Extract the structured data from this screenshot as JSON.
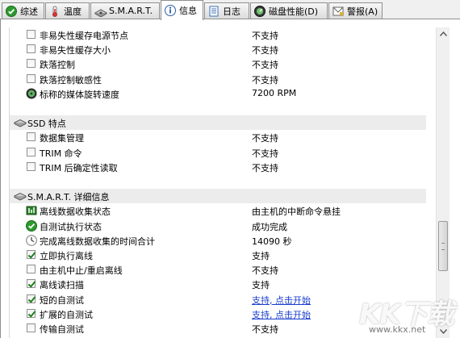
{
  "tabs": [
    {
      "label": "综述",
      "icon": "green-check-icon",
      "active": false
    },
    {
      "label": "温度",
      "icon": "thermometer-icon",
      "active": false
    },
    {
      "label": "S.M.A.R.T.",
      "icon": "hard-drive-icon",
      "active": false
    },
    {
      "label": "信息",
      "icon": "info-icon",
      "active": true
    },
    {
      "label": "日志",
      "icon": "log-document-icon",
      "active": false
    },
    {
      "label": "磁盘性能(D)",
      "icon": "performance-gauge-icon",
      "active": false
    },
    {
      "label": "警报(A)",
      "icon": "alert-envelope-icon",
      "active": false
    }
  ],
  "rows": [
    {
      "type": "row",
      "label": "非易失性缓存电源节点",
      "value": "不支持",
      "icon": "checkbox",
      "checked": false
    },
    {
      "type": "row",
      "label": "非易失性缓存大小",
      "value": "不支持",
      "icon": "checkbox",
      "checked": false
    },
    {
      "type": "row",
      "label": "跌落控制",
      "value": "不支持",
      "icon": "checkbox",
      "checked": false
    },
    {
      "type": "row",
      "label": "跌落控制敏感性",
      "value": "不支持",
      "icon": "checkbox",
      "checked": false
    },
    {
      "type": "row",
      "label": "标称的媒体旋转速度",
      "value": "7200 RPM",
      "icon": "spin-disc-icon"
    },
    {
      "type": "blank"
    },
    {
      "type": "section",
      "label": "SSD 特点"
    },
    {
      "type": "row",
      "label": "数据集管理",
      "value": "不支持",
      "icon": "checkbox",
      "checked": false
    },
    {
      "type": "row",
      "label": "TRIM 命令",
      "value": "不支持",
      "icon": "checkbox",
      "checked": false
    },
    {
      "type": "row",
      "label": "TRIM 后确定性读取",
      "value": "不支持",
      "icon": "checkbox",
      "checked": false
    },
    {
      "type": "blank"
    },
    {
      "type": "section",
      "label": "S.M.A.R.T. 详细信息"
    },
    {
      "type": "row",
      "label": "离线数据收集状态",
      "value": "由主机的中断命令悬挂",
      "icon": "data-collect-icon"
    },
    {
      "type": "row",
      "label": "自测试执行状态",
      "value": "成功完成",
      "icon": "green-check-circle-icon"
    },
    {
      "type": "row",
      "label": "完成离线数据收集的时间合计",
      "value": "14090 秒",
      "icon": "clock-icon"
    },
    {
      "type": "row",
      "label": "立即执行离线",
      "value": "支持",
      "icon": "checkbox",
      "checked": true
    },
    {
      "type": "row",
      "label": "由主机中止/重启离线",
      "value": "不支持",
      "icon": "checkbox",
      "checked": false
    },
    {
      "type": "row",
      "label": "离线读扫描",
      "value": "支持",
      "icon": "checkbox",
      "checked": true
    },
    {
      "type": "row",
      "label": "短的自测试",
      "value": "支持, 点击开始",
      "icon": "checkbox",
      "checked": true,
      "link": true
    },
    {
      "type": "row",
      "label": "扩展的自测试",
      "value": "支持, 点击开始",
      "icon": "checkbox",
      "checked": true,
      "link": true
    },
    {
      "type": "row",
      "label": "传输自测试",
      "value": "不支持",
      "icon": "checkbox",
      "checked": false
    }
  ],
  "watermark": {
    "logo": "KK下载",
    "url": "www.kkx.net"
  }
}
